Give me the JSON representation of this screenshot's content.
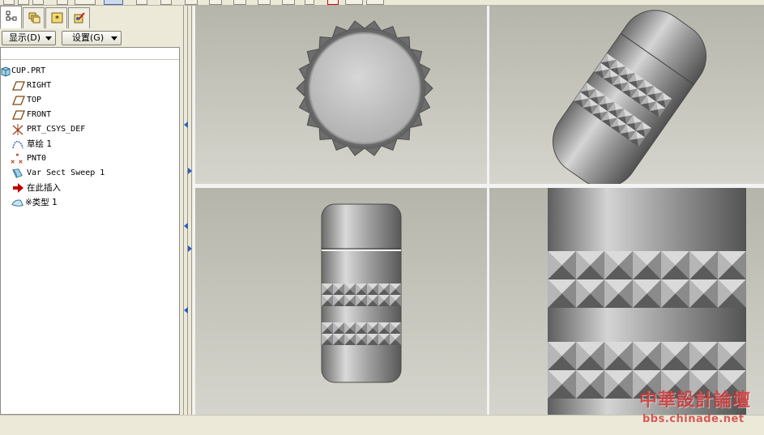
{
  "nav": {
    "tabs": [
      "model-tree-icon",
      "layers-icon",
      "favorites-icon",
      "appearance-icon"
    ],
    "show_label": "显示(D)",
    "settings_label": "设置(G)"
  },
  "tree": {
    "items": [
      {
        "label": "CUP.PRT",
        "icon": "part-icon"
      },
      {
        "label": "RIGHT",
        "icon": "datum-plane-icon"
      },
      {
        "label": "TOP",
        "icon": "datum-plane-icon"
      },
      {
        "label": "FRONT",
        "icon": "datum-plane-icon"
      },
      {
        "label": "PRT_CSYS_DEF",
        "icon": "coordinate-system-icon"
      },
      {
        "label": "草绘 1",
        "icon": "sketch-icon"
      },
      {
        "label": "PNT0",
        "icon": "datum-point-icon"
      },
      {
        "label": "Var Sect Sweep 1",
        "icon": "sweep-icon"
      },
      {
        "label": "在此插入",
        "icon": "insert-here-arrow-icon"
      },
      {
        "label": "※类型 1",
        "icon": "surface-feature-icon"
      }
    ]
  },
  "watermark": {
    "title": "中華設計論壇",
    "url": "bbs.chinade.net"
  },
  "colors": {
    "accent": "#2a5fb8",
    "insert_arrow": "#c00000",
    "watermark": "#d02828"
  }
}
